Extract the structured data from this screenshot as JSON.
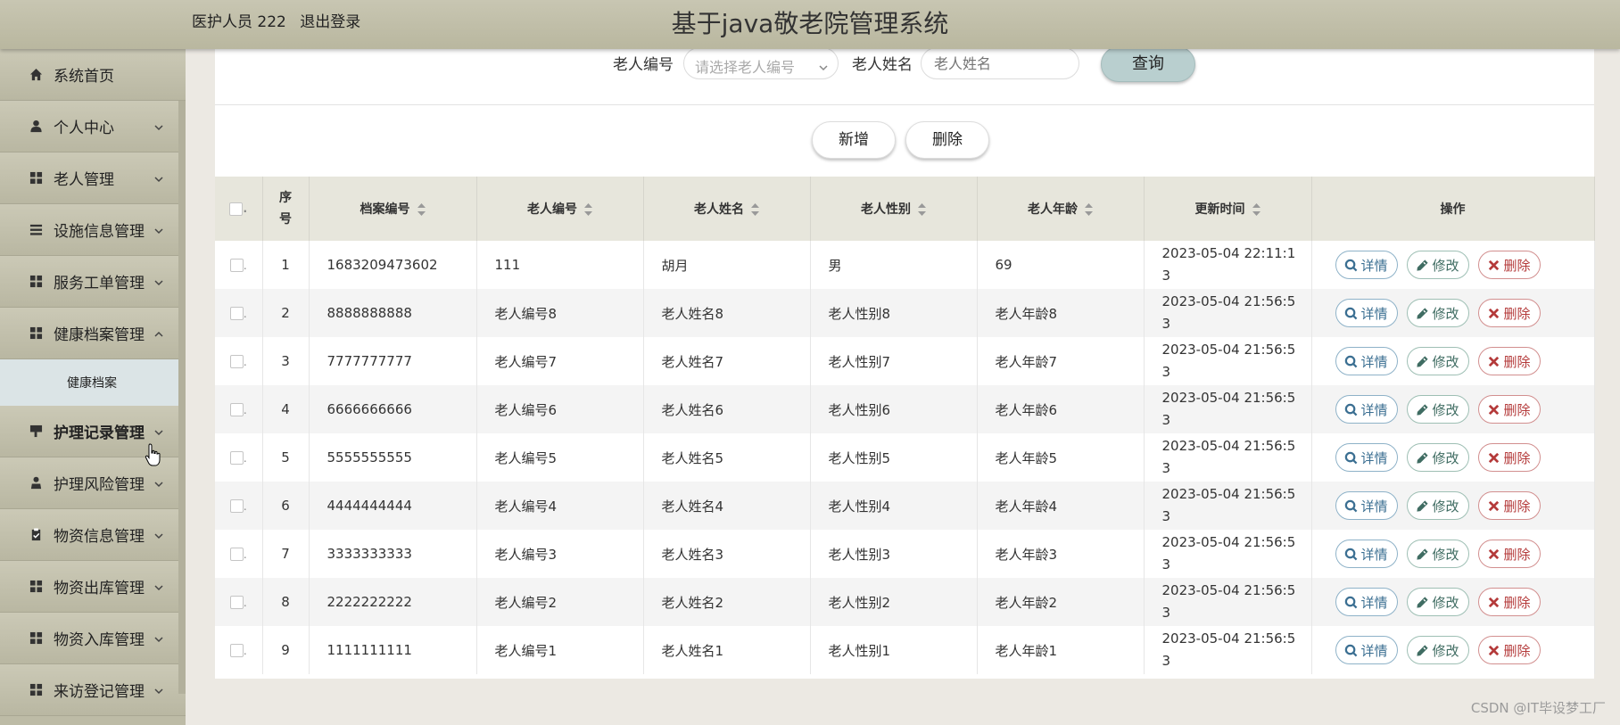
{
  "header": {
    "user": "医护人员 222",
    "logout": "退出登录",
    "title": "基于java敬老院管理系统"
  },
  "sidebar": {
    "items": [
      {
        "label": "系统首页",
        "icon": "home-icon"
      },
      {
        "label": "个人中心",
        "icon": "user-icon"
      },
      {
        "label": "老人管理",
        "icon": "grid-icon"
      },
      {
        "label": "设施信息管理",
        "icon": "list-icon"
      },
      {
        "label": "服务工单管理",
        "icon": "grid-icon"
      },
      {
        "label": "健康档案管理",
        "icon": "grid-icon"
      },
      {
        "label": "护理记录管理",
        "icon": "flag-icon"
      },
      {
        "label": "护理风险管理",
        "icon": "person-icon"
      },
      {
        "label": "物资信息管理",
        "icon": "clipboard-icon"
      },
      {
        "label": "物资出库管理",
        "icon": "grid-icon"
      },
      {
        "label": "物资入库管理",
        "icon": "grid-icon"
      },
      {
        "label": "来访登记管理",
        "icon": "grid-icon"
      }
    ],
    "sub_item": "健康档案"
  },
  "search": {
    "elder_no_label": "老人编号",
    "elder_no_placeholder": "请选择老人编号",
    "elder_name_label": "老人姓名",
    "elder_name_placeholder": "老人姓名",
    "query_button": "查询"
  },
  "actions": {
    "add": "新增",
    "delete": "删除"
  },
  "table": {
    "headers": {
      "index": "序号",
      "record_no": "档案编号",
      "elder_no": "老人编号",
      "elder_name": "老人姓名",
      "gender": "老人性别",
      "age": "老人年龄",
      "update_time": "更新时间",
      "ops": "操作"
    },
    "op_labels": {
      "detail": "详情",
      "edit": "修改",
      "delete": "删除"
    },
    "rows": [
      {
        "index": "1",
        "record_no": "1683209473602",
        "elder_no": "111",
        "elder_name": "胡月",
        "gender": "男",
        "age": "69",
        "update_time": "2023-05-04 22:11:13"
      },
      {
        "index": "2",
        "record_no": "8888888888",
        "elder_no": "老人编号8",
        "elder_name": "老人姓名8",
        "gender": "老人性别8",
        "age": "老人年龄8",
        "update_time": "2023-05-04 21:56:53"
      },
      {
        "index": "3",
        "record_no": "7777777777",
        "elder_no": "老人编号7",
        "elder_name": "老人姓名7",
        "gender": "老人性别7",
        "age": "老人年龄7",
        "update_time": "2023-05-04 21:56:53"
      },
      {
        "index": "4",
        "record_no": "6666666666",
        "elder_no": "老人编号6",
        "elder_name": "老人姓名6",
        "gender": "老人性别6",
        "age": "老人年龄6",
        "update_time": "2023-05-04 21:56:53"
      },
      {
        "index": "5",
        "record_no": "5555555555",
        "elder_no": "老人编号5",
        "elder_name": "老人姓名5",
        "gender": "老人性别5",
        "age": "老人年龄5",
        "update_time": "2023-05-04 21:56:53"
      },
      {
        "index": "6",
        "record_no": "4444444444",
        "elder_no": "老人编号4",
        "elder_name": "老人姓名4",
        "gender": "老人性别4",
        "age": "老人年龄4",
        "update_time": "2023-05-04 21:56:53"
      },
      {
        "index": "7",
        "record_no": "3333333333",
        "elder_no": "老人编号3",
        "elder_name": "老人姓名3",
        "gender": "老人性别3",
        "age": "老人年龄3",
        "update_time": "2023-05-04 21:56:53"
      },
      {
        "index": "8",
        "record_no": "2222222222",
        "elder_no": "老人编号2",
        "elder_name": "老人姓名2",
        "gender": "老人性别2",
        "age": "老人年龄2",
        "update_time": "2023-05-04 21:56:53"
      },
      {
        "index": "9",
        "record_no": "1111111111",
        "elder_no": "老人编号1",
        "elder_name": "老人姓名1",
        "gender": "老人性别1",
        "age": "老人年龄1",
        "update_time": "2023-05-04 21:56:53"
      }
    ]
  },
  "watermark": "CSDN @IT毕设梦工厂"
}
